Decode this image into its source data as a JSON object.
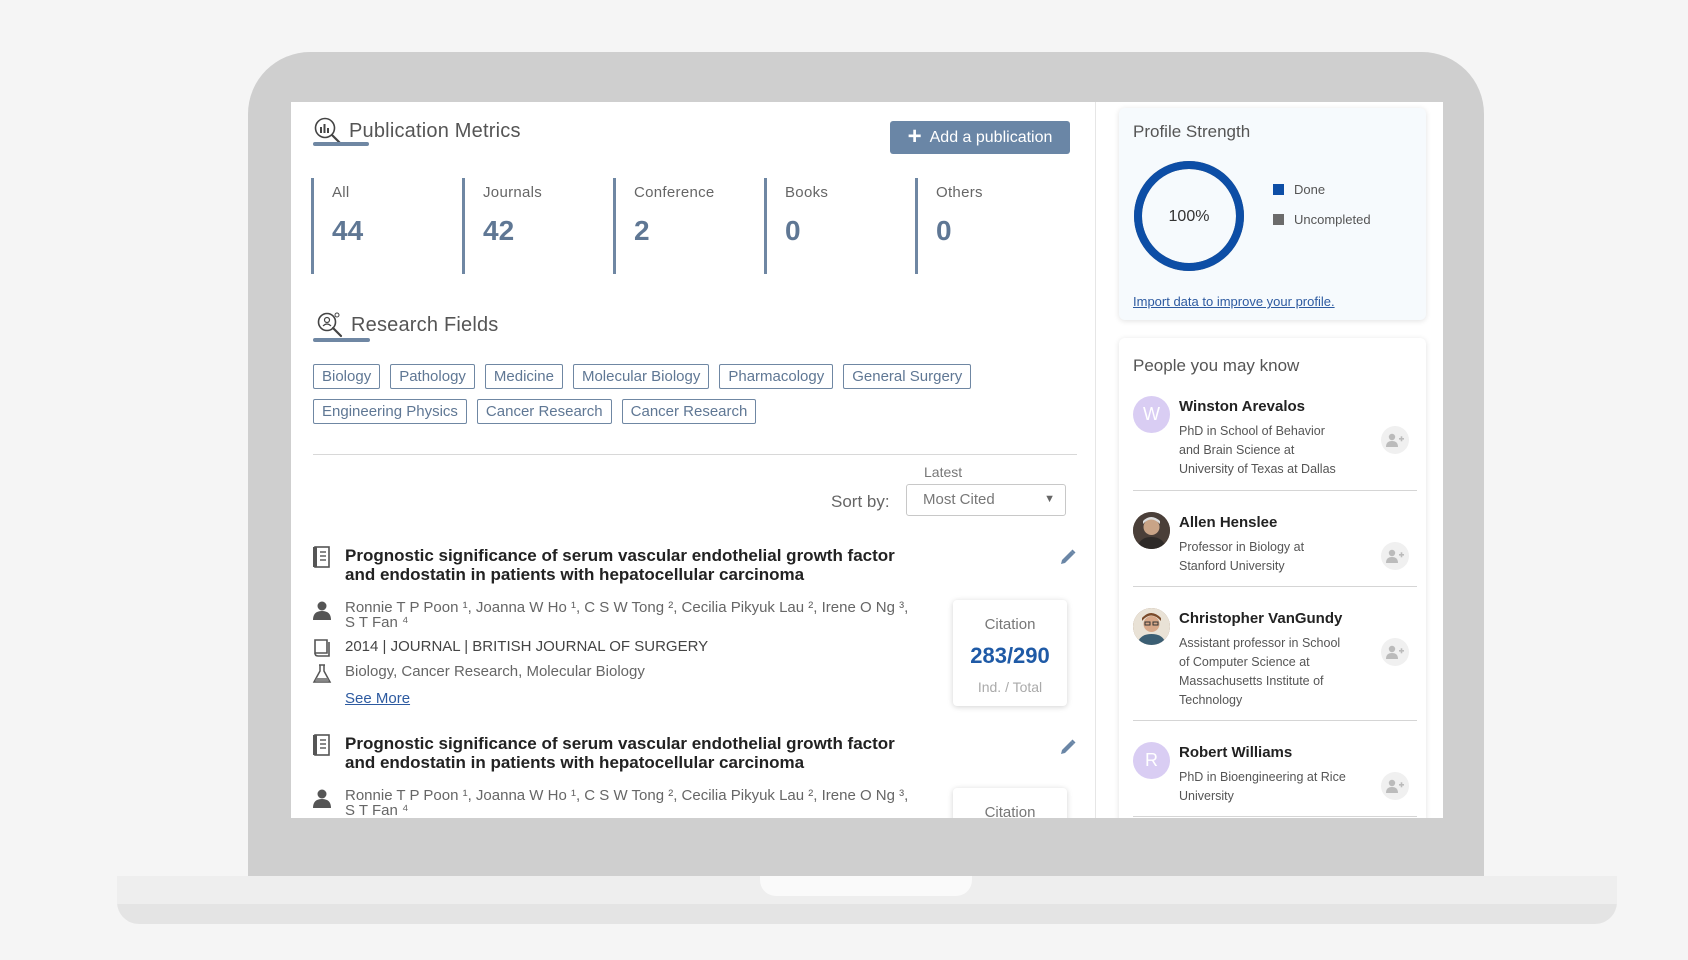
{
  "metrics_section": {
    "title": "Publication Metrics",
    "add_button_label": "Add a publication",
    "metrics": [
      {
        "label": "All",
        "value": "44"
      },
      {
        "label": "Journals",
        "value": "42"
      },
      {
        "label": "Conference",
        "value": "2"
      },
      {
        "label": "Books",
        "value": "0"
      },
      {
        "label": "Others",
        "value": "0"
      }
    ]
  },
  "research_fields": {
    "title": "Research Fields",
    "tags": [
      "Biology",
      "Pathology",
      "Medicine",
      "Molecular Biology",
      "Pharmacology",
      "General Surgery",
      "Engineering Physics",
      "Cancer Research",
      "Cancer Research"
    ]
  },
  "sort": {
    "latest_label": "Latest",
    "label": "Sort by:",
    "selected": "Most Cited",
    "caret": "▼"
  },
  "publications": [
    {
      "title": "Prognostic significance of serum vascular endothelial growth factor and endostatin in patients with hepatocellular carcinoma",
      "authors_line1": "Ronnie T P Poon ¹, Joanna W Ho ¹, C S W Tong ², Cecilia Pikyuk Lau ², Irene O Ng ³,",
      "authors_line2": "S T Fan ⁴",
      "year": "2014",
      "source": " | JOURNAL | BRITISH JOURNAL OF SURGERY",
      "fields": "Biology, Cancer Research, Molecular Biology",
      "see_more": "See More",
      "citation_label": "Citation",
      "citation_value": "283/290",
      "citation_sub": "Ind. / Total"
    },
    {
      "title": "Prognostic significance of serum vascular endothelial growth factor and endostatin in patients with hepatocellular carcinoma",
      "authors_line1": "Ronnie T P Poon ¹, Joanna W Ho ¹, C S W Tong ², Cecilia Pikyuk Lau ², Irene O Ng ³,",
      "authors_line2": "S T Fan ⁴",
      "citation_label": "Citation"
    }
  ],
  "profile_strength": {
    "title": "Profile Strength",
    "percent_label": "100%",
    "percent": 100,
    "legend_done": "Done",
    "legend_uncompleted": "Uncompleted",
    "import_link": "Import data to improve your profile.",
    "colors": {
      "done": "#0d4ea6",
      "uncompleted": "#6b6b6b"
    }
  },
  "people": {
    "title": "People you may know",
    "list": [
      {
        "name": "Winston Arevalos",
        "desc": "PhD in School of Behavior and Brain Science at University of Texas at Dallas",
        "initial": "W",
        "avatar_color": "#d9cdf3"
      },
      {
        "name": "Allen Henslee",
        "desc": "Professor in Biology at Stanford University",
        "initial": "",
        "avatar_color": "#5b4a3e"
      },
      {
        "name": "Christopher VanGundy",
        "desc": "Assistant professor in School of Computer Science at Massachusetts Institute of Technology",
        "initial": "",
        "avatar_color": "#8a6b52"
      },
      {
        "name": "Robert Williams",
        "desc": "PhD in Bioengineering at Rice University",
        "initial": "R",
        "avatar_color": "#d9cdf3"
      }
    ]
  }
}
